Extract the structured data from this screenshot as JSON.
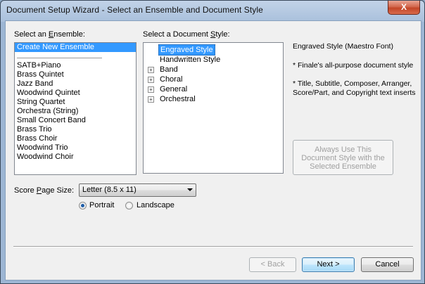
{
  "window": {
    "title": "Document Setup Wizard - Select an Ensemble and Document Style",
    "close_glyph": "X"
  },
  "ensemble": {
    "label": "Select an Ensemble:",
    "items": [
      "Create New Ensemble",
      "SATB+Piano",
      "Brass Quintet",
      "Jazz Band",
      "Woodwind Quintet",
      "String Quartet",
      "Orchestra (String)",
      "Small Concert Band",
      "Brass Trio",
      "Brass Choir",
      "Woodwind Trio",
      "Woodwind Choir"
    ],
    "selected_index": 0
  },
  "style": {
    "label": "Select a Document Style:",
    "items": [
      {
        "label": "Engraved Style",
        "expandable": false,
        "selected": true
      },
      {
        "label": "Handwritten Style",
        "expandable": false,
        "selected": false
      },
      {
        "label": "Band",
        "expandable": true,
        "selected": false
      },
      {
        "label": "Choral",
        "expandable": true,
        "selected": false
      },
      {
        "label": "General",
        "expandable": true,
        "selected": false
      },
      {
        "label": "Orchestral",
        "expandable": true,
        "selected": false
      }
    ]
  },
  "description": {
    "heading": "Engraved Style (Maestro Font)",
    "line1": "* Finale's all-purpose document style",
    "line2": "* Title, Subtitle, Composer, Arranger, Score/Part, and Copyright text inserts"
  },
  "always_use_button": "Always Use This Document Style with the Selected Ensemble",
  "page_size": {
    "label": "Score Page Size:",
    "value": "Letter (8.5 x 11)"
  },
  "orientation": {
    "portrait": "Portrait",
    "landscape": "Landscape",
    "selected": "portrait"
  },
  "buttons": {
    "back": "< Back",
    "next": "Next >",
    "cancel": "Cancel"
  }
}
